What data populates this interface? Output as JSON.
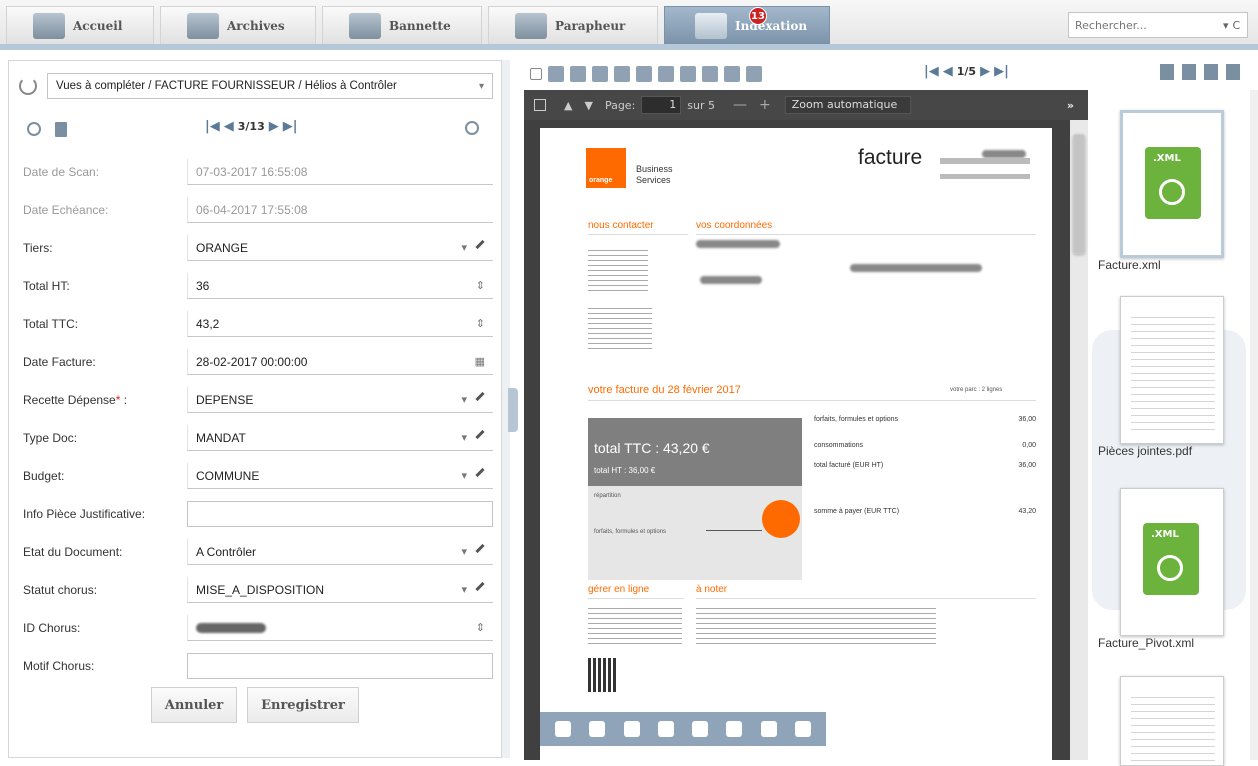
{
  "nav": {
    "tabs": [
      {
        "label": "Accueil",
        "flag_color": "#f2c200"
      },
      {
        "label": "Archives",
        "flag_color": "#7ab51d"
      },
      {
        "label": "Bannette",
        "flag_color": "#1e90d6"
      },
      {
        "label": "Parapheur",
        "flag_color": "#d11f1f"
      },
      {
        "label": "Indexation",
        "flag_color": "#c4163a",
        "badge": "13",
        "active": true
      }
    ],
    "search_placeholder": "Rechercher...",
    "search_suffix": "C"
  },
  "form": {
    "view_path": "Vues à compléter / FACTURE FOURNISSEUR / Hélios à Contrôler",
    "pager": "3/13",
    "fields": [
      {
        "label": "Date de Scan:",
        "value": "07-03-2017 16:55:08"
      },
      {
        "label": "Date Echéance:",
        "value": "06-04-2017 17:55:08"
      },
      {
        "label": "Tiers:",
        "value": "ORANGE"
      },
      {
        "label": "Total HT:",
        "value": "36"
      },
      {
        "label": "Total TTC:",
        "value": "43,2"
      },
      {
        "label": "Date Facture:",
        "value": "28-02-2017 00:00:00"
      },
      {
        "label": "Recette Dépense",
        "required_mark": "*",
        "suffix": ":",
        "value": "DEPENSE"
      },
      {
        "label": "Type Doc:",
        "value": "MANDAT"
      },
      {
        "label": "Budget:",
        "value": "COMMUNE"
      },
      {
        "label": "Info Pièce Justificative:",
        "value": ""
      },
      {
        "label": "Etat du Document:",
        "value": "A Contrôler"
      },
      {
        "label": "Statut chorus:",
        "value": "MISE_A_DISPOSITION"
      },
      {
        "label": "ID Chorus:",
        "value": ""
      },
      {
        "label": "Motif Chorus:",
        "value": ""
      }
    ],
    "cancel_label": "Annuler",
    "save_label": "Enregistrer"
  },
  "viewer": {
    "doc_pager": "1/5",
    "page_label": "Page:",
    "page_value": "1",
    "page_of": "sur 5",
    "zoom": "Zoom automatique",
    "more": "»"
  },
  "invoice": {
    "logo_text": "orange",
    "brand_line1": "Business",
    "brand_line2": "Services",
    "title": "facture",
    "contact_heading": "nous contacter",
    "coords_heading": "vos coordonnées",
    "invoice_heading": "votre facture du 28 février 2017",
    "lines_note": "votre parc : 2 lignes",
    "total_ttc": "total TTC : 43,20 €",
    "total_ht": "total HT : 36,00 €",
    "rows": [
      {
        "label": "forfaits, formules et options",
        "value": "36,00"
      },
      {
        "label": "consommations",
        "value": "0,00"
      },
      {
        "label": "total facturé (EUR HT)",
        "value": "36,00"
      },
      {
        "label": "somme à payer (EUR TTC)",
        "value": "43,20"
      }
    ],
    "repartition": "répartition",
    "forfaits": "forfaits, formules et options",
    "online_heading": "gérer en ligne",
    "note_heading": "à noter"
  },
  "attachments": [
    {
      "name": "Facture.xml",
      "kind": "xml",
      "tag": ".XML"
    },
    {
      "name": "Pièces jointes.pdf",
      "kind": "pdf"
    },
    {
      "name": "Facture_Pivot.xml",
      "kind": "xml",
      "tag": ".XML"
    }
  ]
}
